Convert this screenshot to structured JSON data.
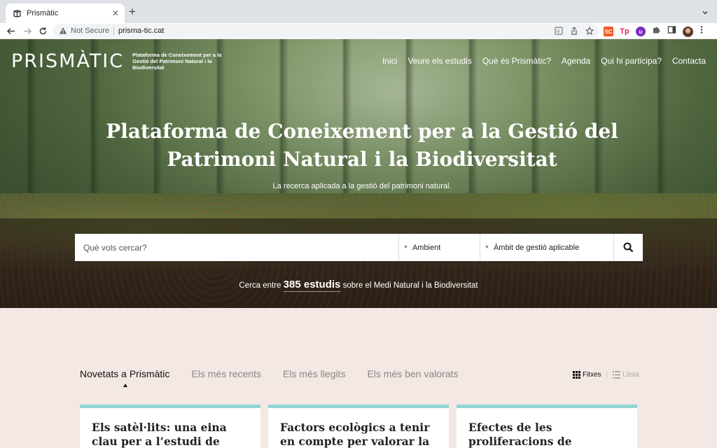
{
  "browser": {
    "tab_title": "Prismàtic",
    "new_tab": "+",
    "not_secure": "Not Secure",
    "url": "prisma-tic.cat",
    "extensions": [
      "SC",
      "Tp",
      "u"
    ]
  },
  "site": {
    "logo_text": "PRISMÀTIC",
    "logo_tagline": "Plataforma de Coneixement per a la Gestió del Patrimoni Natural i la Biodiversitat",
    "nav": [
      "Inici",
      "Veure els estudis",
      "Què és Prismàtic?",
      "Agenda",
      "Qui hi participa?",
      "Contacta"
    ]
  },
  "hero": {
    "title_line1": "Plataforma de Coneixement per a la Gestió del",
    "title_line2": "Patrimoni Natural i la Biodiversitat",
    "subtitle": "La recerca aplicada a la gestió del patrimoni natural."
  },
  "search": {
    "placeholder": "Què vols cercar?",
    "select_ambient": "Ambient",
    "select_ambit": "Àmbit de gestió aplicable",
    "count_prefix": "Cerca entre",
    "count_number": "385 estudis",
    "count_suffix": "sobre el Medi Natural i la Biodiversitat"
  },
  "content": {
    "tabs": [
      "Novetats a Prismàtic",
      "Els més recents",
      "Els més llegits",
      "Els més ben valorats"
    ],
    "view_fitxes": "Fitxes",
    "view_llista": "Llista",
    "cards": [
      {
        "title": "Els satèl·lits: una eina clau per a l’estudi de l’oceà"
      },
      {
        "title": "Factors ecològics a tenir en compte per valorar la"
      },
      {
        "title": "Efectes de les proliferacions de"
      }
    ],
    "accent_color": "#8fd6d4"
  }
}
